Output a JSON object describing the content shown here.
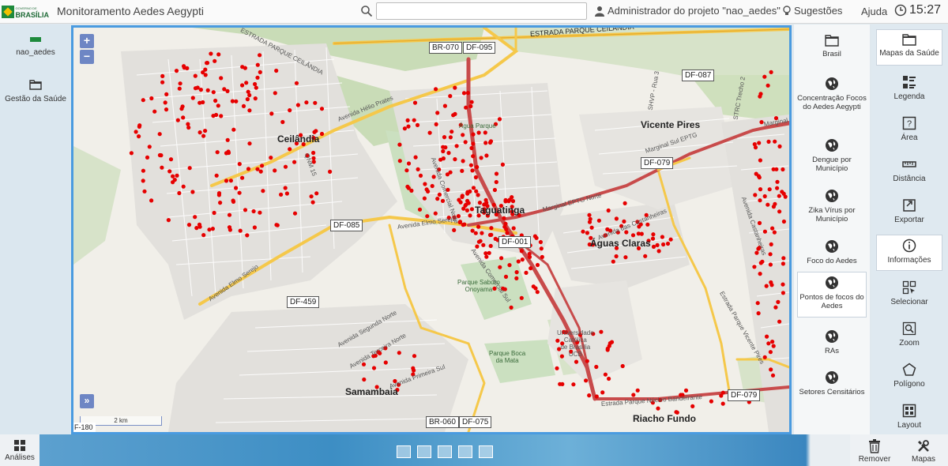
{
  "header": {
    "logo_line1": "GOVERNO DE",
    "logo_line2": "BRASÍLIA",
    "app_title": "Monitoramento Aedes Aegypti",
    "search_placeholder": "",
    "user_label": "Administrador do projeto \"nao_aedes\"",
    "suggestions_label": "Sugestões",
    "help_label": "Ajuda",
    "clock": "15:27"
  },
  "left_panel": {
    "project_label": "nao_aedes",
    "gestao_label": "Gestão da Saúde"
  },
  "map": {
    "zoom_in": "+",
    "zoom_out": "−",
    "expand": "»",
    "scale_label": "2 km",
    "corner_label": "F-180",
    "places": {
      "ceilandia": "Ceilândia",
      "taguatinga": "Taguatinga",
      "vicente_pires": "Vicente Pires",
      "aguas_claras": "Águas Claras",
      "samambaia": "Samambaia",
      "riacho_fundo": "Riacho Fundo"
    },
    "badges": {
      "br070": "BR-070",
      "df095": "DF-095",
      "df087": "DF-087",
      "df079a": "DF-079",
      "df085": "DF-085",
      "df001": "DF-001",
      "df459": "DF-459",
      "br060": "BR-060",
      "df075": "DF-075",
      "df079b": "DF-079"
    },
    "streets": {
      "estrada_ceilandia": "ESTRADA PARQUE CEILÂNDIA",
      "parque_ceilandia_diag": "ESTRADA PARQUE CEILÂNDIA",
      "helio_prates": "Avenida Hélio Prates",
      "elmo_serejo": "Avenida Elmo Serejo",
      "elmo_serejo_2": "Avenida Elmo Serejo",
      "marginal_eptg": "Marginal EPTG Norte",
      "marginal_sul": "Marginal Sul EPTG",
      "marginal_right": "Marginal",
      "castanheiras": "Avenida das Castanheiras",
      "segunda_norte": "Avenida Segunda Norte",
      "terceira_norte": "Avenida Terceira Norte",
      "primeira_sul": "Avenida Primeira Sul",
      "nucleo_bandeirante": "Estrada Parque Núcleo Bandeirante",
      "vicente_pires_road": "Estrada Parque Vicente Pires",
      "comercial_norte": "Avenida Comercial Norte",
      "comercial_sul": "Avenida Comercial Sul",
      "qnm": "QNM 15",
      "svpf": "SHVP - Rua 3",
      "strc": "STRC Trecho 2",
      "castanheiras_right": "Avenida Castanheiras"
    },
    "green_areas": {
      "agua_parque": "Água Parque",
      "saburo": "Parque Saburo\nOnoyama",
      "boca_mata": "Parque Boca\nda Mata",
      "ucb": "Universidade\nCatólica\nde Brasília\nUCB"
    }
  },
  "right_panel_1": {
    "items": [
      {
        "label": "Brasil"
      },
      {
        "label": "Concentração Focos do Aedes Aegypti"
      },
      {
        "label": "Dengue por Município"
      },
      {
        "label": "Zika Vírus por Município"
      },
      {
        "label": "Foco do Aedes"
      },
      {
        "label": "Pontos de focos do Aedes"
      },
      {
        "label": "RAs"
      },
      {
        "label": "Setores Censitários"
      }
    ]
  },
  "right_panel_2": {
    "items": [
      {
        "label": "Mapas da Saúde"
      },
      {
        "label": "Legenda"
      },
      {
        "label": "Área"
      },
      {
        "label": "Distância"
      },
      {
        "label": "Exportar"
      },
      {
        "label": "Informações"
      },
      {
        "label": "Selecionar"
      },
      {
        "label": "Zoom"
      },
      {
        "label": "Polígono"
      },
      {
        "label": "Layout"
      }
    ]
  },
  "bottom": {
    "analises_label": "Análises",
    "remover_label": "Remover",
    "mapas_label": "Mapas"
  },
  "colors": {
    "accent_blue": "#4a9be0",
    "point_red": "#e60000",
    "highway_red": "#c84b4b",
    "road_yellow": "#f5c84a"
  }
}
